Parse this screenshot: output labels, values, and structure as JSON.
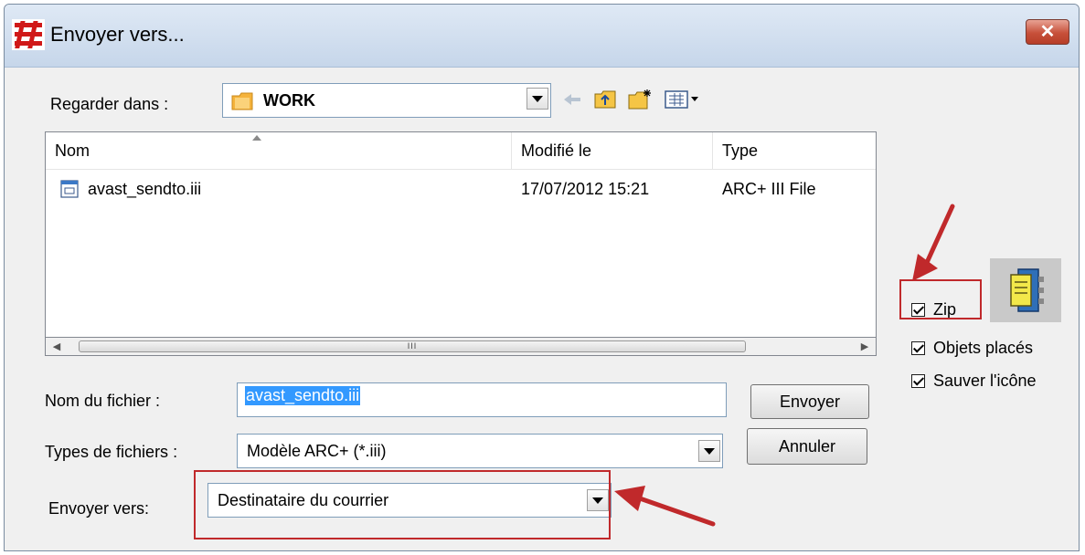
{
  "window": {
    "title": "Envoyer vers...",
    "close_label": "✕"
  },
  "look_in": {
    "label": "Regarder dans :",
    "value": "WORK"
  },
  "toolbar": {
    "icons": [
      "back-arrow-icon",
      "up-folder-icon",
      "new-folder-icon",
      "view-menu-icon"
    ]
  },
  "file_list": {
    "columns": [
      "Nom",
      "Modifié le",
      "Type"
    ],
    "rows": [
      {
        "name": "avast_sendto.iii",
        "modified": "17/07/2012 15:21",
        "type": "ARC+ III File"
      }
    ],
    "scroll_thumb": "III"
  },
  "file_name": {
    "label": "Nom du fichier :",
    "value": "avast_sendto.iii"
  },
  "file_type": {
    "label": "Types de fichiers :",
    "value": "Modèle ARC+ (*.iii)"
  },
  "send_to": {
    "label": "Envoyer vers:",
    "value": "Destinataire du courrier"
  },
  "buttons": {
    "send": "Envoyer",
    "cancel": "Annuler"
  },
  "options": [
    {
      "label": "Zip",
      "checked": true
    },
    {
      "label": "Objets placés",
      "checked": true
    },
    {
      "label": "Sauver l'icône",
      "checked": true
    }
  ],
  "colors": {
    "highlight": "#c0292b",
    "selection": "#3399ff",
    "folder": "#f5b33b"
  }
}
